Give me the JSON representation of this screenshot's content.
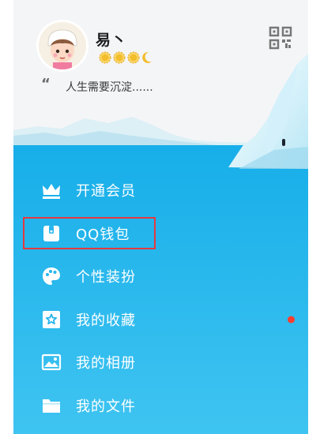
{
  "profile": {
    "name": "易丶",
    "signature": "人生需要沉淀......",
    "quote_mark": "“"
  },
  "menu": {
    "items": [
      {
        "label": "开通会员"
      },
      {
        "label": "QQ钱包"
      },
      {
        "label": "个性装扮"
      },
      {
        "label": "我的收藏"
      },
      {
        "label": "我的相册"
      },
      {
        "label": "我的文件"
      }
    ]
  },
  "colors": {
    "menu_background": "#26b6ee",
    "highlight_box": "#e43a3f",
    "notification_dot": "#ff3d2e",
    "level_icon": "#f3bd2e"
  },
  "icons": {
    "qr": "qr-code-icon",
    "vip": "crown-icon",
    "wallet": "wallet-icon",
    "theme": "palette-icon",
    "favorites": "star-icon",
    "album": "photo-icon",
    "files": "folder-icon",
    "level_sun": "sun-icon",
    "level_moon": "moon-icon"
  }
}
